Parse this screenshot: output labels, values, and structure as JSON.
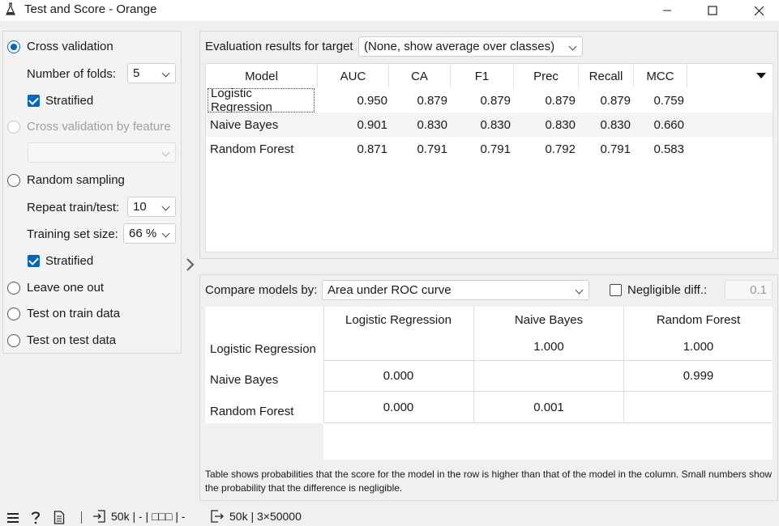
{
  "window": {
    "title": "Test and Score - Orange",
    "icon": "flask-icon"
  },
  "sampling": {
    "cross_validation": {
      "label": "Cross validation",
      "selected": true,
      "folds_label": "Number of folds:",
      "folds_value": "5",
      "stratified_label": "Stratified",
      "stratified": true
    },
    "cv_by_feature": {
      "label": "Cross validation by feature",
      "enabled": false,
      "value": ""
    },
    "random_sampling": {
      "label": "Random sampling",
      "selected": false,
      "repeat_label": "Repeat train/test:",
      "repeat_value": "10",
      "train_size_label": "Training set size:",
      "train_size_value": "66 %",
      "stratified_label": "Stratified",
      "stratified": true
    },
    "leave_one_out": {
      "label": "Leave one out",
      "selected": false
    },
    "test_on_train": {
      "label": "Test on train data",
      "selected": false
    },
    "test_on_test": {
      "label": "Test on test data",
      "selected": false
    }
  },
  "evaluation": {
    "target_label": "Evaluation results for target",
    "target_value": "(None, show average over classes)",
    "columns": [
      "Model",
      "AUC",
      "CA",
      "F1",
      "Prec",
      "Recall",
      "MCC"
    ],
    "rows": [
      [
        "Logistic Regression",
        "0.950",
        "0.879",
        "0.879",
        "0.879",
        "0.879",
        "0.759"
      ],
      [
        "Naive Bayes",
        "0.901",
        "0.830",
        "0.830",
        "0.830",
        "0.830",
        "0.660"
      ],
      [
        "Random Forest",
        "0.871",
        "0.791",
        "0.791",
        "0.792",
        "0.791",
        "0.583"
      ]
    ]
  },
  "compare": {
    "label": "Compare models by:",
    "value": "Area under ROC curve",
    "negligible_label": "Negligible diff.:",
    "negligible_checked": false,
    "negligible_value": "0.1",
    "columns": [
      "Logistic Regression",
      "Naive Bayes",
      "Random Forest"
    ],
    "rows": [
      {
        "name": "Logistic Regression",
        "values": [
          "",
          "1.000",
          "1.000"
        ]
      },
      {
        "name": "Naive Bayes",
        "values": [
          "0.000",
          "",
          "0.999"
        ]
      },
      {
        "name": "Random Forest",
        "values": [
          "0.000",
          "0.001",
          ""
        ]
      }
    ],
    "note": "Table shows probabilities that the score for the model in the row is higher than that of the model in the column. Small numbers show the probability that the difference is negligible."
  },
  "statusbar": {
    "input_summary": "50k | - | □□□ | -",
    "output_summary": "50k | 3×50000"
  }
}
